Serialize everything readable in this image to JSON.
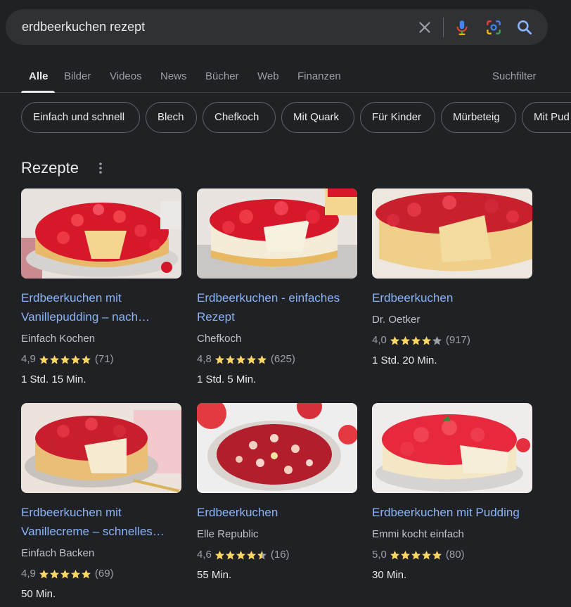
{
  "search": {
    "query": "erdbeerkuchen rezept"
  },
  "tabs": [
    {
      "label": "Alle"
    },
    {
      "label": "Bilder"
    },
    {
      "label": "Videos"
    },
    {
      "label": "News"
    },
    {
      "label": "Bücher"
    },
    {
      "label": "Web"
    },
    {
      "label": "Finanzen"
    }
  ],
  "tools_label": "Suchfilter",
  "chips": [
    "Einfach und schnell",
    "Blech",
    "Chefkoch",
    "Mit Quark",
    "Für Kinder",
    "Mürbeteig",
    "Mit Pud"
  ],
  "section": {
    "title": "Rezepte"
  },
  "recipes": [
    {
      "title": "Erdbeerkuchen mit Vanillepudding – nach…",
      "source": "Einfach Kochen",
      "rating": "4,9",
      "stars": 5,
      "reviews": "(71)",
      "time": "1 Std. 15 Min."
    },
    {
      "title": "Erdbeerkuchen - einfaches Rezept",
      "source": "Chefkoch",
      "rating": "4,8",
      "stars": 5,
      "reviews": "(625)",
      "time": "1 Std. 5 Min."
    },
    {
      "title": "Erdbeerkuchen",
      "source": "Dr. Oetker",
      "rating": "4,0",
      "stars": 4,
      "reviews": "(917)",
      "time": "1 Std. 20 Min."
    },
    {
      "title": "Erdbeerkuchen mit Vanillecreme – schnelles…",
      "source": "Einfach Backen",
      "rating": "4,9",
      "stars": 5,
      "reviews": "(69)",
      "time": "50 Min."
    },
    {
      "title": "Erdbeerkuchen",
      "source": "Elle Republic",
      "rating": "4,6",
      "stars": 4.5,
      "reviews": "(16)",
      "time": "55 Min."
    },
    {
      "title": "Erdbeerkuchen mit Pudding",
      "source": "Emmi kocht einfach",
      "rating": "5,0",
      "stars": 5,
      "reviews": "(80)",
      "time": "30 Min."
    }
  ],
  "colors": {
    "background": "#202124",
    "link": "#8ab4f8",
    "star": "#fdd663",
    "star_empty": "#9aa0a6"
  }
}
